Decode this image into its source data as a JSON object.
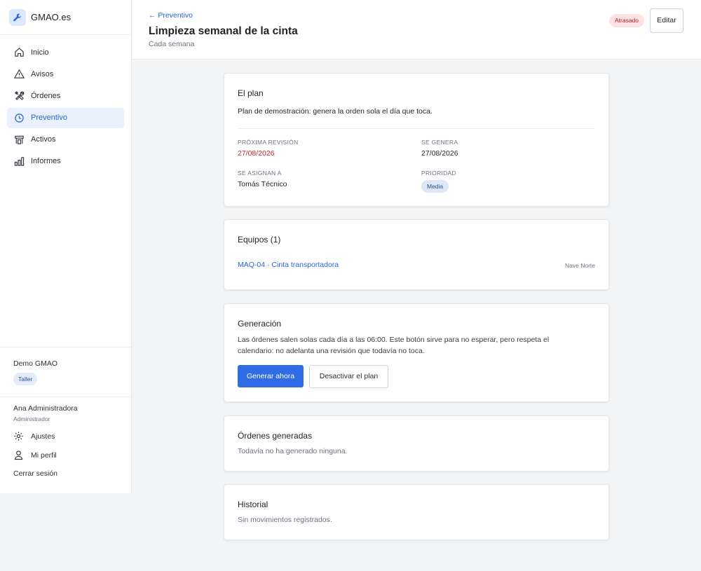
{
  "app": {
    "name": "GMAO.es"
  },
  "sidebar": {
    "items": [
      {
        "label": "Inicio",
        "icon": "home-icon"
      },
      {
        "label": "Avisos",
        "icon": "warning-icon"
      },
      {
        "label": "Órdenes",
        "icon": "tools-icon"
      },
      {
        "label": "Preventivo",
        "icon": "clock-icon",
        "active": true
      },
      {
        "label": "Activos",
        "icon": "asset-icon"
      },
      {
        "label": "Informes",
        "icon": "bar-chart-icon"
      }
    ],
    "org": {
      "name": "Demo GMAO",
      "badge": "Taller"
    },
    "user": {
      "name": "Ana Administradora",
      "role": "Administrador"
    },
    "links": {
      "settings": "Ajustes",
      "profile": "Mi perfil",
      "logout": "Cerrar sesión"
    }
  },
  "header": {
    "back": "← Preventivo",
    "title": "Limpieza semanal de la cinta",
    "subtitle": "Cada semana",
    "status": "Atrasado",
    "edit": "Editar"
  },
  "plan": {
    "title": "El plan",
    "description": "Plan de demostración: genera la orden sola el día que toca.",
    "next_label": "PRÓXIMA REVISIÓN",
    "next_value": "27/08/2026",
    "generated_label": "SE GENERA",
    "generated_value": "27/08/2026",
    "assigned_label": "SE ASIGNAN A",
    "assigned_value": "Tomás Técnico",
    "priority_label": "PRIORIDAD",
    "priority_value": "Media"
  },
  "equipment": {
    "title": "Equipos (1)",
    "items": [
      {
        "name": "MAQ-04 · Cinta transportadora",
        "location": "Nave Norte"
      }
    ]
  },
  "generation": {
    "title": "Generación",
    "text": "Las órdenes salen solas cada día a las 06:00. Este botón sirve para no esperar, pero respeta el calendario: no adelanta una revisión que todavía no toca.",
    "generate_now": "Generar ahora",
    "deactivate": "Desactivar el plan"
  },
  "orders": {
    "title": "Órdenes generadas",
    "empty": "Todavía no ha generado ninguna."
  },
  "history": {
    "title": "Historial",
    "empty": "Sin movimientos registrados."
  },
  "colors": {
    "accent": "#2f6ce5",
    "danger": "#c1272d",
    "status_bg": "#fde2e2"
  }
}
